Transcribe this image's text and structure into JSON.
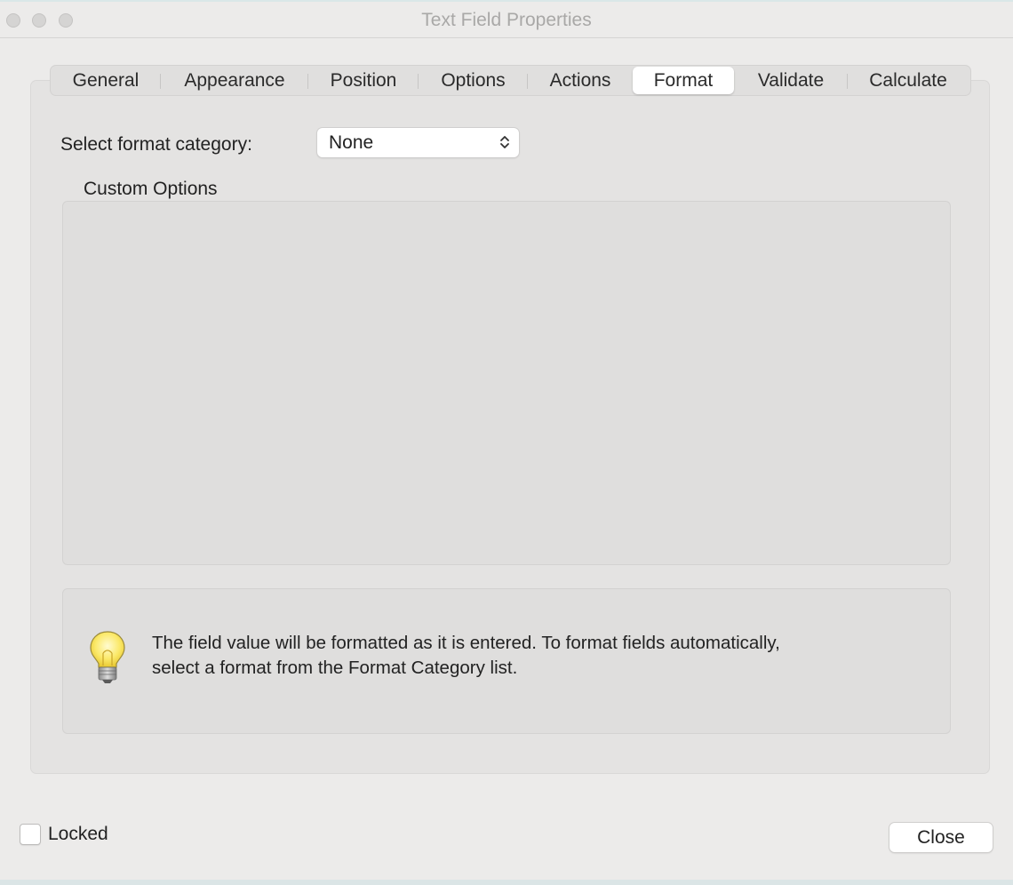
{
  "window": {
    "title": "Text Field Properties"
  },
  "tabs": [
    {
      "label": "General"
    },
    {
      "label": "Appearance"
    },
    {
      "label": "Position"
    },
    {
      "label": "Options"
    },
    {
      "label": "Actions"
    },
    {
      "label": "Format",
      "active": true
    },
    {
      "label": "Validate"
    },
    {
      "label": "Calculate"
    }
  ],
  "format": {
    "category_label": "Select format category:",
    "category_value": "None",
    "custom_options_label": "Custom Options"
  },
  "info": {
    "icon": "lightbulb-icon",
    "line1": "The field value will be formatted as it is entered. To format fields automatically,",
    "line2": "select a format from the Format Category list."
  },
  "footer": {
    "locked_label": "Locked",
    "locked_checked": false,
    "close_label": "Close"
  },
  "colors": {
    "window_bg": "#ecebea",
    "panel_bg": "#e4e3e2",
    "active_tab_bg": "#ffffff"
  }
}
